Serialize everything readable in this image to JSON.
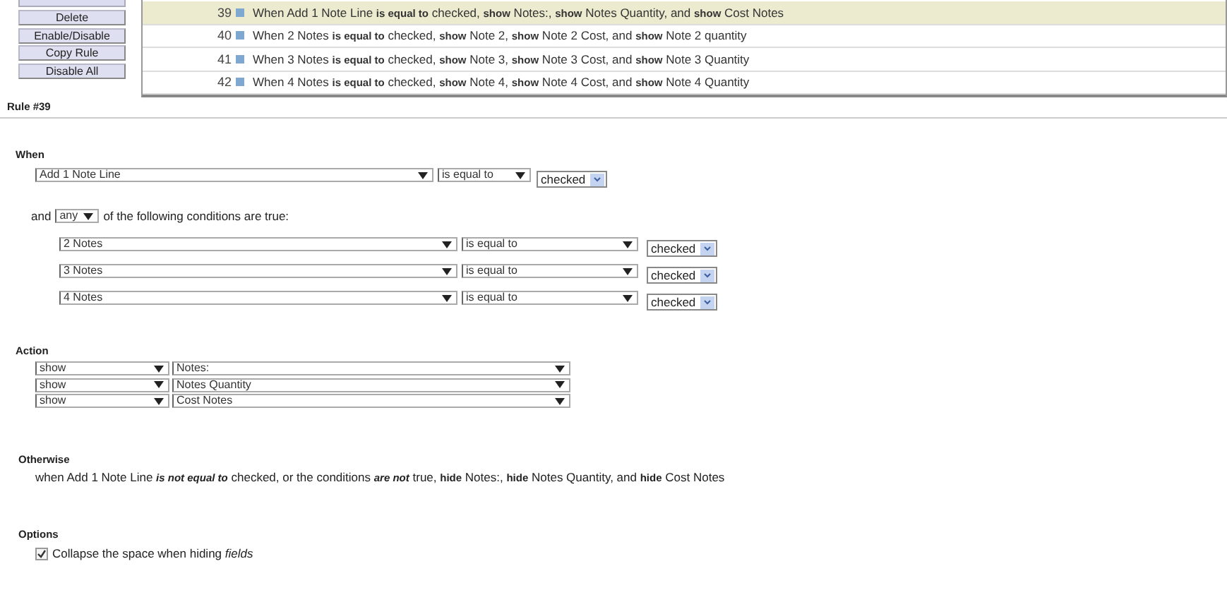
{
  "sidebar_buttons": [
    {
      "label": "Delete"
    },
    {
      "label": "Enable/Disable"
    },
    {
      "label": "Copy Rule"
    },
    {
      "label": "Disable All"
    }
  ],
  "rules": [
    {
      "number": "39",
      "text": "When Add 1 Note Line **is equal to** checked, **show** Notes:, **show** Notes Quantity, and **show** Cost Notes",
      "selected": true
    },
    {
      "number": "40",
      "text": "When 2 Notes **is equal to** checked, **show** Note 2, **show** Note 2 Cost, and **show** Note 2 quantity",
      "selected": false
    },
    {
      "number": "41",
      "text": "When 3 Notes **is equal to** checked, **show** Note 3, **show** Note 3 Cost, and **show** Note 3 Quantity",
      "selected": false
    },
    {
      "number": "42",
      "text": "When 4 Notes **is equal to** checked, **show** Note 4, **show** Note 4 Cost, and **show** Note 4 Quantity",
      "selected": false
    }
  ],
  "rule_title": "Rule #39",
  "when": {
    "heading": "When",
    "field": "Add 1 Note Line",
    "operator": "is equal to",
    "value": "checked"
  },
  "conditions": {
    "prefix": "and",
    "match": "any",
    "suffix": "of the following conditions are true:",
    "rows": [
      {
        "field": "2 Notes",
        "operator": "is equal to",
        "value": "checked"
      },
      {
        "field": "3 Notes",
        "operator": "is equal to",
        "value": "checked"
      },
      {
        "field": "4 Notes",
        "operator": "is equal to",
        "value": "checked"
      }
    ]
  },
  "action": {
    "heading": "Action",
    "rows": [
      {
        "verb": "show",
        "target": "Notes:"
      },
      {
        "verb": "show",
        "target": "Notes Quantity"
      },
      {
        "verb": "show",
        "target": "Cost Notes"
      }
    ]
  },
  "otherwise": {
    "heading": "Otherwise",
    "text": "when Add 1 Note Line **is not equal to** checked, or the conditions **are not** true, **hide** Notes:, **hide** Notes Quantity, and **hide** Cost Notes"
  },
  "options": {
    "heading": "Options",
    "items": [
      {
        "label": "Collapse the space when hiding *fields*",
        "checked": true
      }
    ]
  }
}
